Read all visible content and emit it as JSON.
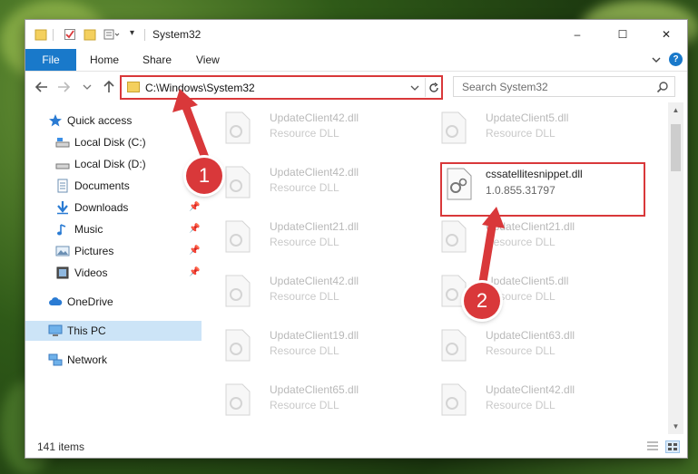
{
  "window": {
    "title": "System32",
    "controls": [
      "–",
      "☐",
      "✕"
    ]
  },
  "ribbon": {
    "file_label": "File",
    "tabs": [
      "Home",
      "Share",
      "View"
    ],
    "expand_icon": "chevron-down-icon",
    "help_label": "?"
  },
  "nav": {
    "address": "C:\\Windows\\System32",
    "search_placeholder": "Search System32"
  },
  "sidebar": {
    "items": [
      {
        "label": "Quick access",
        "icon": "star-icon"
      },
      {
        "label": "Local Disk (C:)",
        "icon": "drive-icon"
      },
      {
        "label": "Local Disk (D:)",
        "icon": "drive-icon"
      },
      {
        "label": "Documents",
        "icon": "documents-icon"
      },
      {
        "label": "Downloads",
        "icon": "download-icon"
      },
      {
        "label": "Music",
        "icon": "music-icon"
      },
      {
        "label": "Pictures",
        "icon": "pictures-icon"
      },
      {
        "label": "Videos",
        "icon": "videos-icon"
      },
      {
        "label": "OneDrive",
        "icon": "cloud-icon"
      },
      {
        "label": "This PC",
        "icon": "computer-icon"
      },
      {
        "label": "Network",
        "icon": "network-icon"
      }
    ]
  },
  "files": {
    "left": [
      {
        "name": "UpdateClient42.dll",
        "desc": "Resource DLL"
      },
      {
        "name": "UpdateClient42.dll",
        "desc": "Resource DLL"
      },
      {
        "name": "UpdateClient21.dll",
        "desc": "Resource DLL"
      },
      {
        "name": "UpdateClient42.dll",
        "desc": "Resource DLL"
      },
      {
        "name": "UpdateClient19.dll",
        "desc": "Resource DLL"
      },
      {
        "name": "UpdateClient65.dll",
        "desc": "Resource DLL"
      }
    ],
    "right": [
      {
        "name": "UpdateClient5.dll",
        "desc": "Resource DLL"
      },
      {
        "name": "cssatellitesnippet.dll",
        "desc": "1.0.855.31797"
      },
      {
        "name": "UpdateClient21.dll",
        "desc": "Resource DLL"
      },
      {
        "name": "UpdateClient5.dll",
        "desc": "Resource DLL"
      },
      {
        "name": "UpdateClient63.dll",
        "desc": "Resource DLL"
      },
      {
        "name": "UpdateClient42.dll",
        "desc": "Resource DLL"
      }
    ]
  },
  "status": {
    "count": "141 items"
  },
  "callouts": [
    "1",
    "2"
  ],
  "colors": {
    "accent": "#1979ca",
    "highlight_red": "#d9383a",
    "selected_bg": "#cce4f7"
  }
}
